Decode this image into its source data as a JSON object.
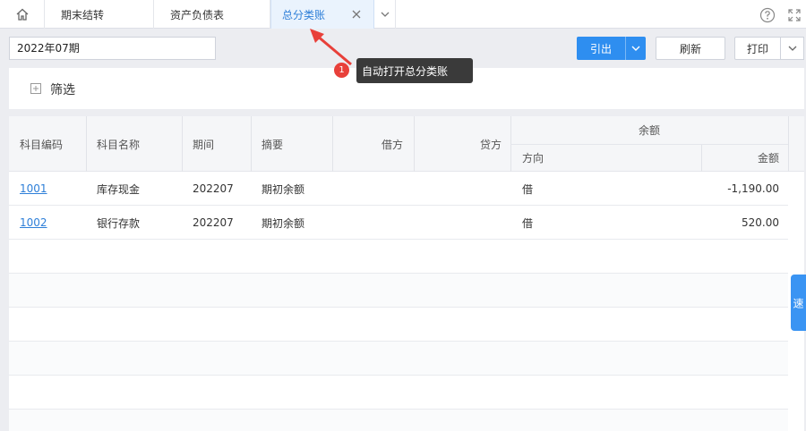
{
  "tabs": [
    {
      "label": "期末结转"
    },
    {
      "label": "资产负债表"
    },
    {
      "label": "总分类账",
      "active": true
    }
  ],
  "toolbar": {
    "period_value": "2022年07期",
    "export_label": "引出",
    "refresh_label": "刷新",
    "print_label": "打印"
  },
  "filter": {
    "label": "筛选"
  },
  "annotation": {
    "badge": "1",
    "text": "自动打开总分类账"
  },
  "table": {
    "headers": {
      "code": "科目编码",
      "name": "科目名称",
      "period": "期间",
      "summary": "摘要",
      "debit": "借方",
      "credit": "贷方",
      "balance": "余额",
      "direction": "方向",
      "amount": "金额"
    },
    "rows": [
      {
        "code": "1001",
        "name": "库存现金",
        "period": "202207",
        "summary": "期初余额",
        "debit": "",
        "credit": "",
        "direction": "借",
        "amount": "-1,190.00"
      },
      {
        "code": "1002",
        "name": "银行存款",
        "period": "202207",
        "summary": "期初余额",
        "debit": "",
        "credit": "",
        "direction": "借",
        "amount": "520.00"
      }
    ]
  },
  "side_tab": {
    "label": "速"
  },
  "colors": {
    "accent": "#2e8ef0",
    "link": "#2e7fd8",
    "badge": "#e8403a",
    "tooltip": "#3a3a3a"
  }
}
